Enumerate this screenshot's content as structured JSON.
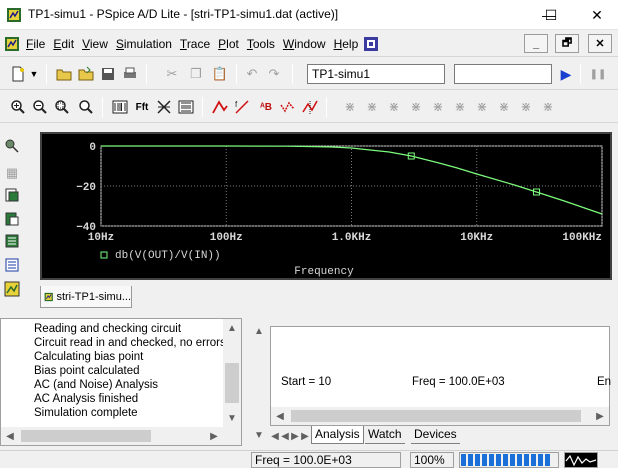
{
  "window": {
    "title": "TP1-simu1 - PSpice A/D Lite  - [stri-TP1-simu1.dat (active)]",
    "minimize_glyph": "—",
    "maximize_glyph": "☐",
    "close_glyph": "✕"
  },
  "menu": {
    "items": [
      "File",
      "Edit",
      "View",
      "Simulation",
      "Trace",
      "Plot",
      "Tools",
      "Window",
      "Help"
    ],
    "mdi_minimize": "_",
    "mdi_restore": "🗗",
    "mdi_close": "✕"
  },
  "toolbar": {
    "profile_combo": "TP1-simu1",
    "second_combo": "",
    "run_glyph": "▶",
    "pause_glyph": "❚❚"
  },
  "plot": {
    "y_ticks": [
      "0",
      "−20",
      "−40"
    ],
    "x_ticks": [
      "10Hz",
      "100Hz",
      "1.0KHz",
      "10KHz",
      "100KHz"
    ],
    "legend": "db(V(OUT)/V(IN))",
    "xlabel": "Frequency",
    "trace_color": "#7cfc7c",
    "grid_color": "#7a7a7a",
    "background": "#000000"
  },
  "plot_tab": {
    "label": "stri-TP1-simu..."
  },
  "log": {
    "lines": [
      "Reading and checking circuit",
      "Circuit read in and checked, no errors",
      "Calculating bias point",
      "Bias point calculated",
      "AC (and Noise) Analysis",
      "AC Analysis finished",
      "Simulation complete"
    ]
  },
  "sim": {
    "start": "Start = 10",
    "freq": "Freq = 100.0E+03",
    "end_partial": "En",
    "tabs": [
      "Analysis",
      "Watch",
      "Devices"
    ]
  },
  "status": {
    "freq": "Freq =  100.0E+03",
    "zoom": "100%",
    "progress_fraction": 1.0
  },
  "chart_data": {
    "type": "line",
    "x_scale": "log",
    "xlim": [
      10,
      100000
    ],
    "ylim": [
      -40,
      0
    ],
    "x_tick_labels": [
      "10Hz",
      "100Hz",
      "1.0KHz",
      "10KHz",
      "100KHz"
    ],
    "y_tick_labels": [
      "0",
      "−20",
      "−40"
    ],
    "xlabel": "Frequency",
    "series": [
      {
        "name": "db(V(OUT)/V(IN))",
        "x": [
          10,
          100,
          300,
          500,
          700,
          1000,
          2000,
          3000,
          5000,
          7000,
          10000,
          20000,
          30000,
          50000,
          100000
        ],
        "y": [
          0,
          0,
          -0.1,
          -0.3,
          -0.5,
          -1.0,
          -3.0,
          -5.0,
          -8.5,
          -11.0,
          -14.0,
          -19.5,
          -23.0,
          -27.5,
          -34.0
        ]
      }
    ],
    "markers_x": [
      3000,
      30000
    ]
  }
}
